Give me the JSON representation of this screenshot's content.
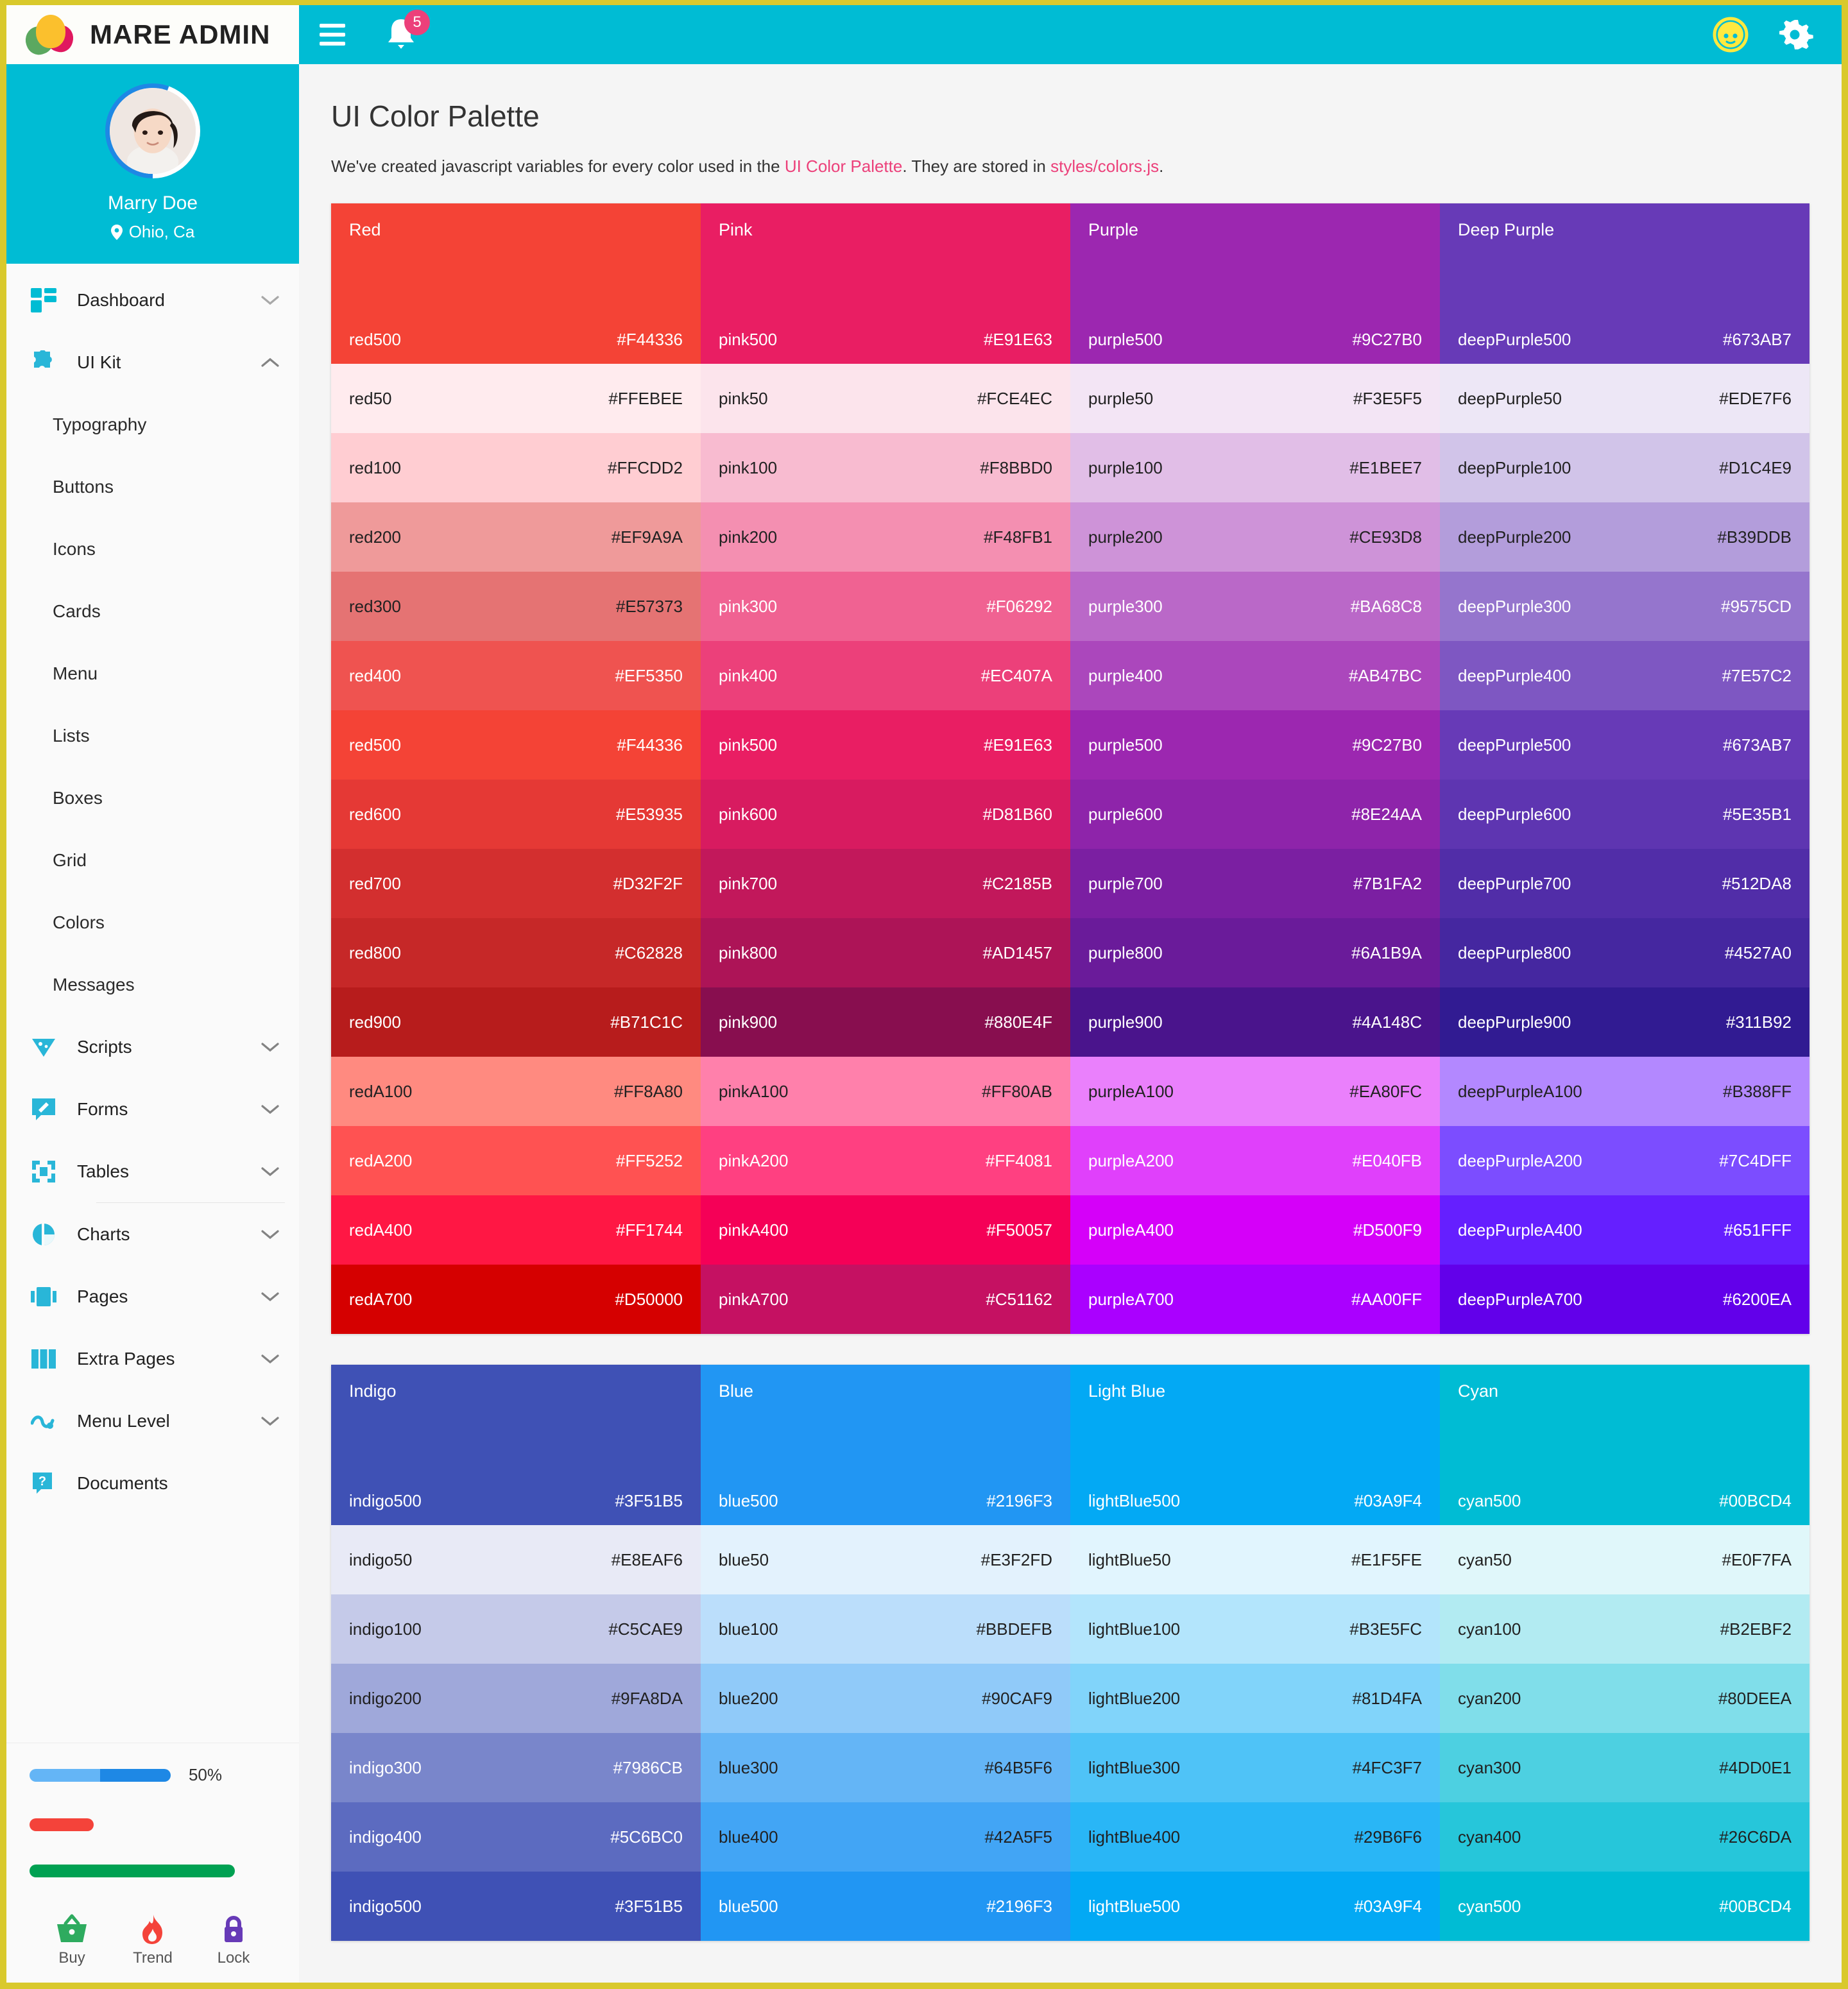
{
  "brand": {
    "title": "MARE ADMIN",
    "logo_icon": "flower-logo-icon"
  },
  "profile": {
    "name": "Marry Doe",
    "location": "Ohio, Ca",
    "location_icon": "map-pin-icon",
    "avatar_icon": "user-avatar"
  },
  "topbar": {
    "menu_icon": "hamburger-menu-icon",
    "bell_icon": "notification-bell-icon",
    "notification_count": "5",
    "user_icon": "user-face-icon",
    "settings_icon": "gear-icon"
  },
  "sidebar": {
    "items": [
      {
        "label": "Dashboard",
        "icon": "dashboard-grid-icon",
        "chevron": "chevron-down",
        "expanded": false
      },
      {
        "label": "UI Kit",
        "icon": "puzzle-piece-icon",
        "chevron": "chevron-up",
        "expanded": true
      },
      {
        "label": "Scripts",
        "icon": "script-icon",
        "chevron": "chevron-down",
        "expanded": false
      },
      {
        "label": "Forms",
        "icon": "form-pencil-icon",
        "chevron": "chevron-down",
        "expanded": false
      },
      {
        "label": "Tables",
        "icon": "table-expand-icon",
        "chevron": "chevron-down",
        "expanded": false
      },
      {
        "label": "Charts",
        "icon": "pie-chart-icon",
        "chevron": "chevron-down",
        "expanded": false
      },
      {
        "label": "Pages",
        "icon": "pages-icon",
        "chevron": "chevron-down",
        "expanded": false
      },
      {
        "label": "Extra Pages",
        "icon": "columns-icon",
        "chevron": "chevron-down",
        "expanded": false
      },
      {
        "label": "Menu Level",
        "icon": "menu-level-icon",
        "chevron": "chevron-down",
        "expanded": false
      },
      {
        "label": "Documents",
        "icon": "question-doc-icon",
        "chevron": "none",
        "expanded": false
      }
    ],
    "ui_kit_children": [
      "Typography",
      "Buttons",
      "Icons",
      "Cards",
      "Menu",
      "Lists",
      "Boxes",
      "Grid",
      "Colors",
      "Messages"
    ],
    "progress": [
      {
        "name": "blue-progress",
        "percent_label": "50%",
        "value": 50,
        "width_pct": 60,
        "color": "#2196f3",
        "buffer_color": "#64b5f6",
        "buffer_pct": 50
      },
      {
        "name": "red-progress",
        "percent_label": "",
        "value": 25,
        "width_pct": 26,
        "color": "#f44336",
        "buffer_color": "#f44336",
        "buffer_pct": 100
      },
      {
        "name": "green-progress",
        "percent_label": "",
        "value": 90,
        "width_pct": 92,
        "color": "#00a152",
        "buffer_color": "#00a152",
        "buffer_pct": 100
      }
    ],
    "quick_links": [
      {
        "label": "Buy",
        "icon": "shopping-basket-icon",
        "color": "#2eab5f"
      },
      {
        "label": "Trend",
        "icon": "flame-icon",
        "color": "#f4433a"
      },
      {
        "label": "Lock",
        "icon": "padlock-icon",
        "color": "#673ab7"
      }
    ]
  },
  "main": {
    "title": "UI Color Palette",
    "description_before": "We've created javascript variables for every color used in the ",
    "description_link1": "UI Color Palette",
    "description_middle": ". They are stored in ",
    "description_link2": "styles/colors.js",
    "description_after": "."
  },
  "palettes": [
    {
      "columns": [
        {
          "title": "Red",
          "header_bg": "#f44336",
          "header_text": "#ffffff",
          "header_name": "red500",
          "header_hex": "#F44336",
          "rows": [
            {
              "name": "red50",
              "hex": "#FFEBEE",
              "bg": "#FFEBEE",
              "fg": "#212121"
            },
            {
              "name": "red100",
              "hex": "#FFCDD2",
              "bg": "#FFCDD2",
              "fg": "#212121"
            },
            {
              "name": "red200",
              "hex": "#EF9A9A",
              "bg": "#EF9A9A",
              "fg": "#212121"
            },
            {
              "name": "red300",
              "hex": "#E57373",
              "bg": "#E57373",
              "fg": "#212121"
            },
            {
              "name": "red400",
              "hex": "#EF5350",
              "bg": "#EF5350",
              "fg": "#ffffff"
            },
            {
              "name": "red500",
              "hex": "#F44336",
              "bg": "#F44336",
              "fg": "#ffffff"
            },
            {
              "name": "red600",
              "hex": "#E53935",
              "bg": "#E53935",
              "fg": "#ffffff"
            },
            {
              "name": "red700",
              "hex": "#D32F2F",
              "bg": "#D32F2F",
              "fg": "#ffffff"
            },
            {
              "name": "red800",
              "hex": "#C62828",
              "bg": "#C62828",
              "fg": "#ffffff"
            },
            {
              "name": "red900",
              "hex": "#B71C1C",
              "bg": "#B71C1C",
              "fg": "#ffffff"
            },
            {
              "name": "redA100",
              "hex": "#FF8A80",
              "bg": "#FF8A80",
              "fg": "#212121"
            },
            {
              "name": "redA200",
              "hex": "#FF5252",
              "bg": "#FF5252",
              "fg": "#ffffff"
            },
            {
              "name": "redA400",
              "hex": "#FF1744",
              "bg": "#FF1744",
              "fg": "#ffffff"
            },
            {
              "name": "redA700",
              "hex": "#D50000",
              "bg": "#D50000",
              "fg": "#ffffff"
            }
          ]
        },
        {
          "title": "Pink",
          "header_bg": "#e91e63",
          "header_text": "#ffffff",
          "header_name": "pink500",
          "header_hex": "#E91E63",
          "rows": [
            {
              "name": "pink50",
              "hex": "#FCE4EC",
              "bg": "#FCE4EC",
              "fg": "#212121"
            },
            {
              "name": "pink100",
              "hex": "#F8BBD0",
              "bg": "#F8BBD0",
              "fg": "#212121"
            },
            {
              "name": "pink200",
              "hex": "#F48FB1",
              "bg": "#F48FB1",
              "fg": "#212121"
            },
            {
              "name": "pink300",
              "hex": "#F06292",
              "bg": "#F06292",
              "fg": "#ffffff"
            },
            {
              "name": "pink400",
              "hex": "#EC407A",
              "bg": "#EC407A",
              "fg": "#ffffff"
            },
            {
              "name": "pink500",
              "hex": "#E91E63",
              "bg": "#E91E63",
              "fg": "#ffffff"
            },
            {
              "name": "pink600",
              "hex": "#D81B60",
              "bg": "#D81B60",
              "fg": "#ffffff"
            },
            {
              "name": "pink700",
              "hex": "#C2185B",
              "bg": "#C2185B",
              "fg": "#ffffff"
            },
            {
              "name": "pink800",
              "hex": "#AD1457",
              "bg": "#AD1457",
              "fg": "#ffffff"
            },
            {
              "name": "pink900",
              "hex": "#880E4F",
              "bg": "#880E4F",
              "fg": "#ffffff"
            },
            {
              "name": "pinkA100",
              "hex": "#FF80AB",
              "bg": "#FF80AB",
              "fg": "#212121"
            },
            {
              "name": "pinkA200",
              "hex": "#FF4081",
              "bg": "#FF4081",
              "fg": "#ffffff"
            },
            {
              "name": "pinkA400",
              "hex": "#F50057",
              "bg": "#F50057",
              "fg": "#ffffff"
            },
            {
              "name": "pinkA700",
              "hex": "#C51162",
              "bg": "#C51162",
              "fg": "#ffffff"
            }
          ]
        },
        {
          "title": "Purple",
          "header_bg": "#9c27b0",
          "header_text": "#ffffff",
          "header_name": "purple500",
          "header_hex": "#9C27B0",
          "rows": [
            {
              "name": "purple50",
              "hex": "#F3E5F5",
              "bg": "#F3E5F5",
              "fg": "#212121"
            },
            {
              "name": "purple100",
              "hex": "#E1BEE7",
              "bg": "#E1BEE7",
              "fg": "#212121"
            },
            {
              "name": "purple200",
              "hex": "#CE93D8",
              "bg": "#CE93D8",
              "fg": "#212121"
            },
            {
              "name": "purple300",
              "hex": "#BA68C8",
              "bg": "#BA68C8",
              "fg": "#ffffff"
            },
            {
              "name": "purple400",
              "hex": "#AB47BC",
              "bg": "#AB47BC",
              "fg": "#ffffff"
            },
            {
              "name": "purple500",
              "hex": "#9C27B0",
              "bg": "#9C27B0",
              "fg": "#ffffff"
            },
            {
              "name": "purple600",
              "hex": "#8E24AA",
              "bg": "#8E24AA",
              "fg": "#ffffff"
            },
            {
              "name": "purple700",
              "hex": "#7B1FA2",
              "bg": "#7B1FA2",
              "fg": "#ffffff"
            },
            {
              "name": "purple800",
              "hex": "#6A1B9A",
              "bg": "#6A1B9A",
              "fg": "#ffffff"
            },
            {
              "name": "purple900",
              "hex": "#4A148C",
              "bg": "#4A148C",
              "fg": "#ffffff"
            },
            {
              "name": "purpleA100",
              "hex": "#EA80FC",
              "bg": "#EA80FC",
              "fg": "#212121"
            },
            {
              "name": "purpleA200",
              "hex": "#E040FB",
              "bg": "#E040FB",
              "fg": "#ffffff"
            },
            {
              "name": "purpleA400",
              "hex": "#D500F9",
              "bg": "#D500F9",
              "fg": "#ffffff"
            },
            {
              "name": "purpleA700",
              "hex": "#AA00FF",
              "bg": "#AA00FF",
              "fg": "#ffffff"
            }
          ]
        },
        {
          "title": "Deep Purple",
          "header_bg": "#673ab7",
          "header_text": "#ffffff",
          "header_name": "deepPurple500",
          "header_hex": "#673AB7",
          "rows": [
            {
              "name": "deepPurple50",
              "hex": "#EDE7F6",
              "bg": "#EDE7F6",
              "fg": "#212121"
            },
            {
              "name": "deepPurple100",
              "hex": "#D1C4E9",
              "bg": "#D1C4E9",
              "fg": "#212121"
            },
            {
              "name": "deepPurple200",
              "hex": "#B39DDB",
              "bg": "#B39DDB",
              "fg": "#212121"
            },
            {
              "name": "deepPurple300",
              "hex": "#9575CD",
              "bg": "#9575CD",
              "fg": "#ffffff"
            },
            {
              "name": "deepPurple400",
              "hex": "#7E57C2",
              "bg": "#7E57C2",
              "fg": "#ffffff"
            },
            {
              "name": "deepPurple500",
              "hex": "#673AB7",
              "bg": "#673AB7",
              "fg": "#ffffff"
            },
            {
              "name": "deepPurple600",
              "hex": "#5E35B1",
              "bg": "#5E35B1",
              "fg": "#ffffff"
            },
            {
              "name": "deepPurple700",
              "hex": "#512DA8",
              "bg": "#512DA8",
              "fg": "#ffffff"
            },
            {
              "name": "deepPurple800",
              "hex": "#4527A0",
              "bg": "#4527A0",
              "fg": "#ffffff"
            },
            {
              "name": "deepPurple900",
              "hex": "#311B92",
              "bg": "#311B92",
              "fg": "#ffffff"
            },
            {
              "name": "deepPurpleA100",
              "hex": "#B388FF",
              "bg": "#B388FF",
              "fg": "#212121"
            },
            {
              "name": "deepPurpleA200",
              "hex": "#7C4DFF",
              "bg": "#7C4DFF",
              "fg": "#ffffff"
            },
            {
              "name": "deepPurpleA400",
              "hex": "#651FFF",
              "bg": "#651FFF",
              "fg": "#ffffff"
            },
            {
              "name": "deepPurpleA700",
              "hex": "#6200EA",
              "bg": "#6200EA",
              "fg": "#ffffff"
            }
          ]
        }
      ]
    },
    {
      "columns": [
        {
          "title": "Indigo",
          "header_bg": "#3f51b5",
          "header_text": "#ffffff",
          "header_name": "indigo500",
          "header_hex": "#3F51B5",
          "rows": [
            {
              "name": "indigo50",
              "hex": "#E8EAF6",
              "bg": "#E8EAF6",
              "fg": "#212121"
            },
            {
              "name": "indigo100",
              "hex": "#C5CAE9",
              "bg": "#C5CAE9",
              "fg": "#212121"
            },
            {
              "name": "indigo200",
              "hex": "#9FA8DA",
              "bg": "#9FA8DA",
              "fg": "#212121"
            },
            {
              "name": "indigo300",
              "hex": "#7986CB",
              "bg": "#7986CB",
              "fg": "#ffffff"
            },
            {
              "name": "indigo400",
              "hex": "#5C6BC0",
              "bg": "#5C6BC0",
              "fg": "#ffffff"
            },
            {
              "name": "indigo500",
              "hex": "#3F51B5",
              "bg": "#3F51B5",
              "fg": "#ffffff"
            }
          ]
        },
        {
          "title": "Blue",
          "header_bg": "#2196f3",
          "header_text": "#ffffff",
          "header_name": "blue500",
          "header_hex": "#2196F3",
          "rows": [
            {
              "name": "blue50",
              "hex": "#E3F2FD",
              "bg": "#E3F2FD",
              "fg": "#212121"
            },
            {
              "name": "blue100",
              "hex": "#BBDEFB",
              "bg": "#BBDEFB",
              "fg": "#212121"
            },
            {
              "name": "blue200",
              "hex": "#90CAF9",
              "bg": "#90CAF9",
              "fg": "#212121"
            },
            {
              "name": "blue300",
              "hex": "#64B5F6",
              "bg": "#64B5F6",
              "fg": "#212121"
            },
            {
              "name": "blue400",
              "hex": "#42A5F5",
              "bg": "#42A5F5",
              "fg": "#212121"
            },
            {
              "name": "blue500",
              "hex": "#2196F3",
              "bg": "#2196F3",
              "fg": "#ffffff"
            }
          ]
        },
        {
          "title": "Light Blue",
          "header_bg": "#03a9f4",
          "header_text": "#ffffff",
          "header_name": "lightBlue500",
          "header_hex": "#03A9F4",
          "rows": [
            {
              "name": "lightBlue50",
              "hex": "#E1F5FE",
              "bg": "#E1F5FE",
              "fg": "#212121"
            },
            {
              "name": "lightBlue100",
              "hex": "#B3E5FC",
              "bg": "#B3E5FC",
              "fg": "#212121"
            },
            {
              "name": "lightBlue200",
              "hex": "#81D4FA",
              "bg": "#81D4FA",
              "fg": "#212121"
            },
            {
              "name": "lightBlue300",
              "hex": "#4FC3F7",
              "bg": "#4FC3F7",
              "fg": "#212121"
            },
            {
              "name": "lightBlue400",
              "hex": "#29B6F6",
              "bg": "#29B6F6",
              "fg": "#212121"
            },
            {
              "name": "lightBlue500",
              "hex": "#03A9F4",
              "bg": "#03A9F4",
              "fg": "#ffffff"
            }
          ]
        },
        {
          "title": "Cyan",
          "header_bg": "#00bcd4",
          "header_text": "#ffffff",
          "header_name": "cyan500",
          "header_hex": "#00BCD4",
          "rows": [
            {
              "name": "cyan50",
              "hex": "#E0F7FA",
              "bg": "#E0F7FA",
              "fg": "#212121"
            },
            {
              "name": "cyan100",
              "hex": "#B2EBF2",
              "bg": "#B2EBF2",
              "fg": "#212121"
            },
            {
              "name": "cyan200",
              "hex": "#80DEEA",
              "bg": "#80DEEA",
              "fg": "#212121"
            },
            {
              "name": "cyan300",
              "hex": "#4DD0E1",
              "bg": "#4DD0E1",
              "fg": "#212121"
            },
            {
              "name": "cyan400",
              "hex": "#26C6DA",
              "bg": "#26C6DA",
              "fg": "#212121"
            },
            {
              "name": "cyan500",
              "hex": "#00BCD4",
              "bg": "#00BCD4",
              "fg": "#ffffff"
            }
          ]
        }
      ]
    }
  ]
}
